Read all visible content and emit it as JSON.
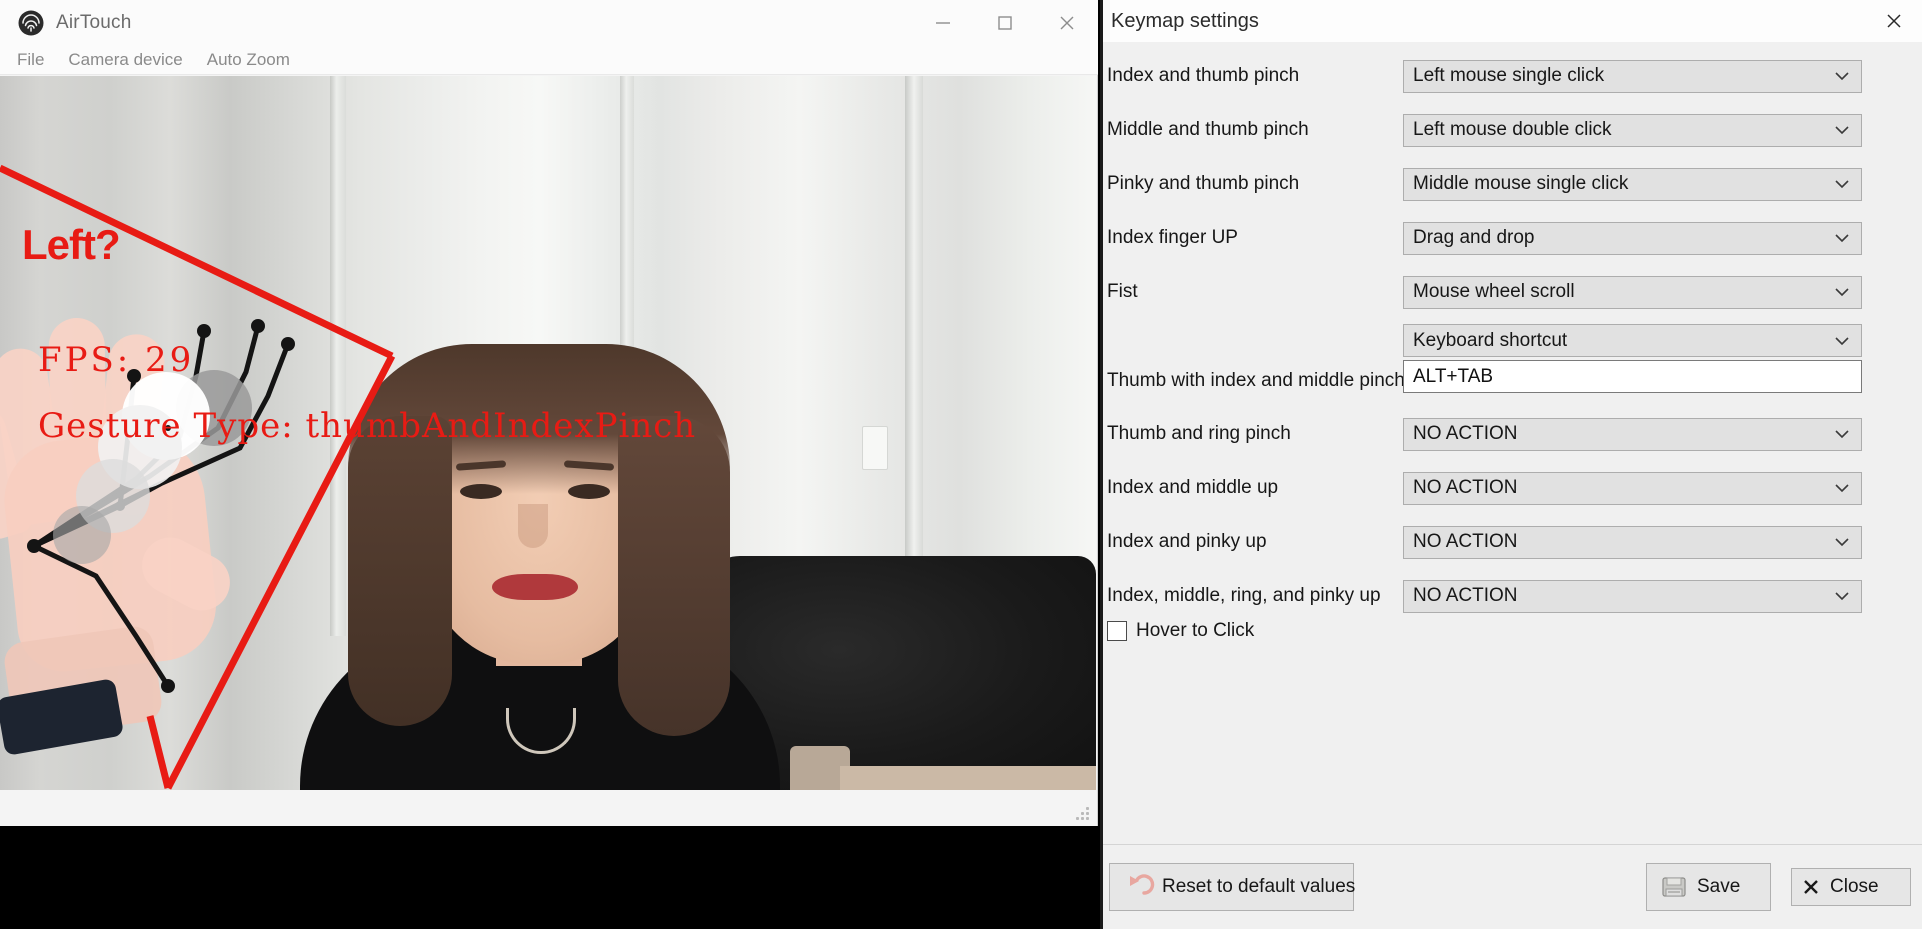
{
  "airtouch_window": {
    "title": "AirTouch",
    "logo_icon": "fingerprint-icon",
    "menu": [
      {
        "label": "File"
      },
      {
        "label": "Camera device"
      },
      {
        "label": "Auto Zoom"
      }
    ],
    "window_controls": [
      {
        "name": "minimize-button",
        "icon": "minimize-icon"
      },
      {
        "name": "maximize-button",
        "icon": "maximize-icon"
      },
      {
        "name": "close-button",
        "icon": "close-icon"
      }
    ],
    "video_overlay": {
      "hand_label": "Left?",
      "fps_text": "FPS: 29",
      "gesture_text": "Gesture Type: thumbAndIndexPinch",
      "overlay_color": "#e81b14",
      "skeleton_color": "#141414"
    }
  },
  "keymap_panel": {
    "title": "Keymap settings",
    "close_icon": "close-icon",
    "chevron_icon": "chevron-down-icon",
    "rows": [
      {
        "label": "Index and thumb pinch",
        "value": "Left mouse single click"
      },
      {
        "label": "Middle and thumb pinch",
        "value": "Left mouse double click"
      },
      {
        "label": "Pinky and thumb pinch",
        "value": "Middle mouse single click"
      },
      {
        "label": "Index finger UP",
        "value": "Drag and drop"
      },
      {
        "label": "Fist",
        "value": "Mouse wheel scroll"
      },
      {
        "label": "Thumb with index and middle pinch",
        "value": "Keyboard shortcut",
        "shortcut": "ALT+TAB"
      },
      {
        "label": "Thumb and ring pinch",
        "value": "NO ACTION"
      },
      {
        "label": "Index and middle up",
        "value": "NO ACTION"
      },
      {
        "label": "Index and pinky up",
        "value": "NO ACTION"
      },
      {
        "label": "Index, middle, ring, and pinky up",
        "value": "NO ACTION"
      }
    ],
    "hover_to_click": {
      "label": "Hover to Click",
      "checked": false
    },
    "footer": {
      "reset_label": "Reset to default values",
      "reset_icon": "undo-arrow-icon",
      "save_label": "Save",
      "save_icon": "floppy-disk-icon",
      "close_label": "Close",
      "close_icon": "x-icon"
    }
  }
}
